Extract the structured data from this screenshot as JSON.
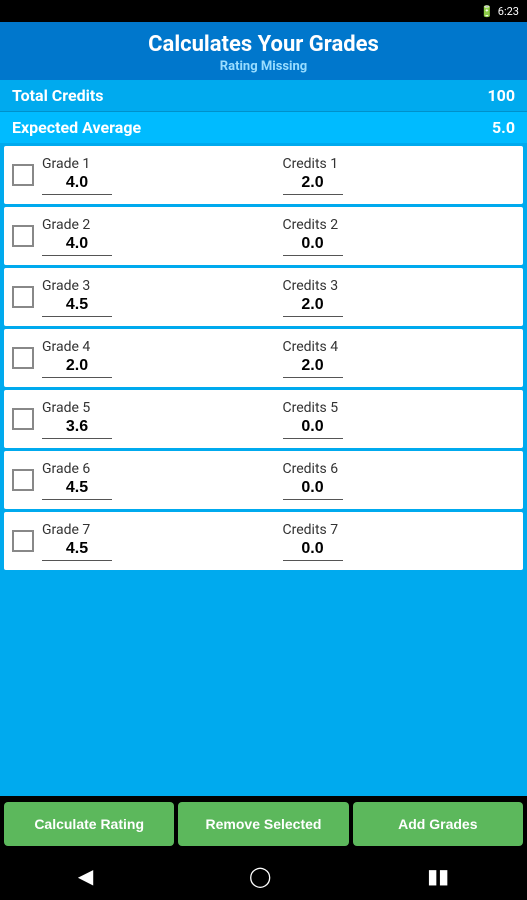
{
  "statusBar": {
    "battery": "🔋",
    "time": "6:23"
  },
  "header": {
    "title": "Calculates Your Grades",
    "subtitle": "Rating Missing"
  },
  "totalCredits": {
    "label": "Total Credits",
    "value": "100"
  },
  "expectedAverage": {
    "label": "Expected Average",
    "value": "5.0"
  },
  "grades": [
    {
      "id": 1,
      "gradeLabel": "Grade  1",
      "gradeValue": "4.0",
      "creditsLabel": "Credits  1",
      "creditsValue": "2.0"
    },
    {
      "id": 2,
      "gradeLabel": "Grade  2",
      "gradeValue": "4.0",
      "creditsLabel": "Credits  2",
      "creditsValue": "0.0"
    },
    {
      "id": 3,
      "gradeLabel": "Grade  3",
      "gradeValue": "4.5",
      "creditsLabel": "Credits  3",
      "creditsValue": "2.0"
    },
    {
      "id": 4,
      "gradeLabel": "Grade  4",
      "gradeValue": "2.0",
      "creditsLabel": "Credits  4",
      "creditsValue": "2.0"
    },
    {
      "id": 5,
      "gradeLabel": "Grade  5",
      "gradeValue": "3.6",
      "creditsLabel": "Credits  5",
      "creditsValue": "0.0"
    },
    {
      "id": 6,
      "gradeLabel": "Grade  6",
      "gradeValue": "4.5",
      "creditsLabel": "Credits  6",
      "creditsValue": "0.0"
    },
    {
      "id": 7,
      "gradeLabel": "Grade  7",
      "gradeValue": "4.5",
      "creditsLabel": "Credits  7",
      "creditsValue": "0.0"
    }
  ],
  "buttons": {
    "calculate": "Calculate Rating",
    "remove": "Remove Selected",
    "add": "Add Grades"
  }
}
